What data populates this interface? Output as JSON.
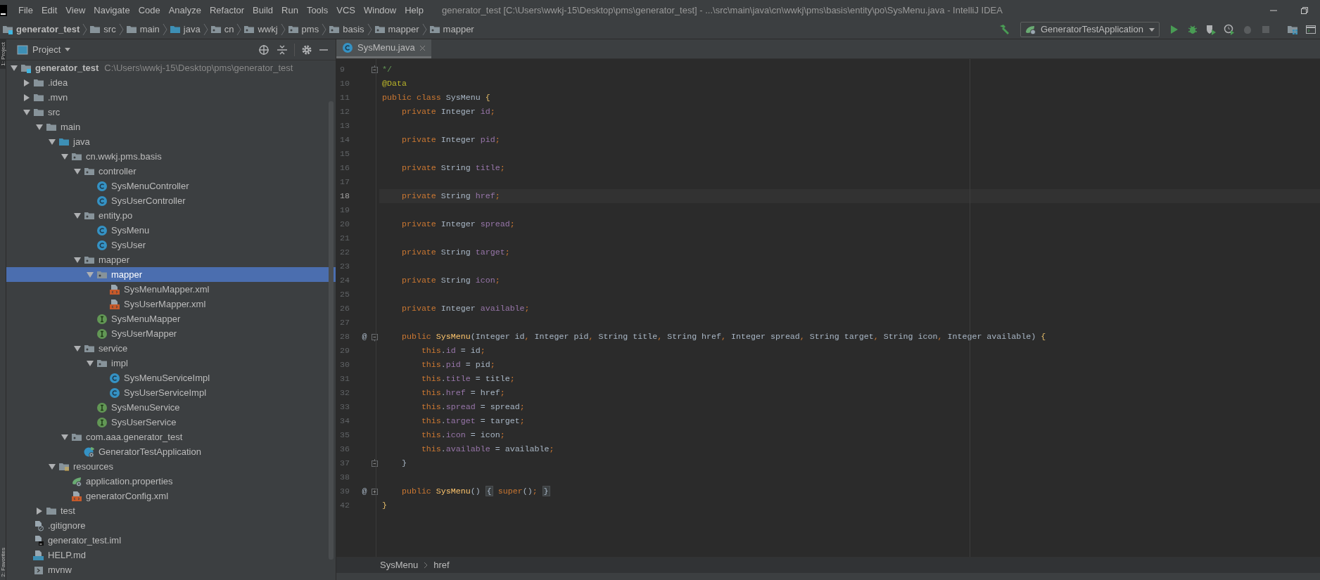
{
  "menu_bar": {
    "items": [
      "File",
      "Edit",
      "View",
      "Navigate",
      "Code",
      "Analyze",
      "Refactor",
      "Build",
      "Run",
      "Tools",
      "VCS",
      "Window",
      "Help"
    ]
  },
  "window": {
    "title": "generator_test [C:\\Users\\wwkj-15\\Desktop\\pms\\generator_test] - ...\\src\\main\\java\\cn\\wwkj\\pms\\basis\\entity\\po\\SysMenu.java - IntelliJ IDEA"
  },
  "navigation_bar": {
    "crumbs": [
      {
        "label": "generator_test",
        "kind": "module"
      },
      {
        "label": "src",
        "kind": "folder"
      },
      {
        "label": "main",
        "kind": "folder"
      },
      {
        "label": "java",
        "kind": "source-folder"
      },
      {
        "label": "cn",
        "kind": "package"
      },
      {
        "label": "wwkj",
        "kind": "package"
      },
      {
        "label": "pms",
        "kind": "package"
      },
      {
        "label": "basis",
        "kind": "package"
      },
      {
        "label": "mapper",
        "kind": "package"
      },
      {
        "label": "mapper",
        "kind": "package"
      }
    ]
  },
  "run_configuration": {
    "label": "GeneratorTestApplication"
  },
  "tool_window_strip": {
    "tabs": [
      {
        "label": "1: Project",
        "selected": true
      },
      {
        "label": "2: Favorites",
        "selected": false
      }
    ]
  },
  "project_panel": {
    "title": "Project",
    "tree": [
      {
        "label": "generator_test",
        "kind": "module",
        "path": "C:\\Users\\wwkj-15\\Desktop\\pms\\generator_test",
        "expanded": true,
        "selected": false,
        "children": [
          {
            "label": ".idea",
            "kind": "folder",
            "expanded": false,
            "selected": false
          },
          {
            "label": ".mvn",
            "kind": "folder",
            "expanded": false,
            "selected": false
          },
          {
            "label": "src",
            "kind": "folder",
            "expanded": true,
            "selected": false,
            "children": [
              {
                "label": "main",
                "kind": "folder",
                "expanded": true,
                "selected": false,
                "children": [
                  {
                    "label": "java",
                    "kind": "source-folder",
                    "expanded": true,
                    "selected": false,
                    "children": [
                      {
                        "label": "cn.wwkj.pms.basis",
                        "kind": "package",
                        "expanded": true,
                        "selected": false,
                        "children": [
                          {
                            "label": "controller",
                            "kind": "package",
                            "expanded": true,
                            "selected": false,
                            "children": [
                              {
                                "label": "SysMenuController",
                                "kind": "class",
                                "selected": false
                              },
                              {
                                "label": "SysUserController",
                                "kind": "class",
                                "selected": false
                              }
                            ]
                          },
                          {
                            "label": "entity.po",
                            "kind": "package",
                            "expanded": true,
                            "selected": false,
                            "children": [
                              {
                                "label": "SysMenu",
                                "kind": "class",
                                "selected": false
                              },
                              {
                                "label": "SysUser",
                                "kind": "class",
                                "selected": false
                              }
                            ]
                          },
                          {
                            "label": "mapper",
                            "kind": "package",
                            "expanded": true,
                            "selected": false,
                            "children": [
                              {
                                "label": "mapper",
                                "kind": "package",
                                "expanded": true,
                                "selected": true,
                                "children": [
                                  {
                                    "label": "SysMenuMapper.xml",
                                    "kind": "xml",
                                    "selected": false
                                  },
                                  {
                                    "label": "SysUserMapper.xml",
                                    "kind": "xml",
                                    "selected": false
                                  }
                                ]
                              },
                              {
                                "label": "SysMenuMapper",
                                "kind": "interface",
                                "selected": false
                              },
                              {
                                "label": "SysUserMapper",
                                "kind": "interface",
                                "selected": false
                              }
                            ]
                          },
                          {
                            "label": "service",
                            "kind": "package",
                            "expanded": true,
                            "selected": false,
                            "children": [
                              {
                                "label": "impl",
                                "kind": "package",
                                "expanded": true,
                                "selected": false,
                                "children": [
                                  {
                                    "label": "SysMenuServiceImpl",
                                    "kind": "class",
                                    "selected": false
                                  },
                                  {
                                    "label": "SysUserServiceImpl",
                                    "kind": "class",
                                    "selected": false
                                  }
                                ]
                              },
                              {
                                "label": "SysMenuService",
                                "kind": "interface",
                                "selected": false
                              },
                              {
                                "label": "SysUserService",
                                "kind": "interface",
                                "selected": false
                              }
                            ]
                          }
                        ]
                      },
                      {
                        "label": "com.aaa.generator_test",
                        "kind": "package",
                        "expanded": true,
                        "selected": false,
                        "children": [
                          {
                            "label": "GeneratorTestApplication",
                            "kind": "spring-class",
                            "selected": false
                          }
                        ]
                      }
                    ]
                  },
                  {
                    "label": "resources",
                    "kind": "resources-folder",
                    "expanded": true,
                    "selected": false,
                    "children": [
                      {
                        "label": "application.properties",
                        "kind": "properties",
                        "selected": false
                      },
                      {
                        "label": "generatorConfig.xml",
                        "kind": "xml",
                        "selected": false
                      }
                    ]
                  }
                ]
              },
              {
                "label": "test",
                "kind": "folder",
                "expanded": false,
                "selected": false
              }
            ]
          },
          {
            "label": ".gitignore",
            "kind": "gitignore",
            "selected": false
          },
          {
            "label": "generator_test.iml",
            "kind": "iml",
            "selected": false
          },
          {
            "label": "HELP.md",
            "kind": "markdown",
            "selected": false
          },
          {
            "label": "mvnw",
            "kind": "script",
            "selected": false
          }
        ]
      }
    ]
  },
  "editor": {
    "tabs": [
      {
        "label": "SysMenu.java",
        "selected": true
      }
    ],
    "lines": [
      {
        "number": "9",
        "current": false,
        "fold": {
          "kind": "end"
        },
        "tokens": [
          {
            "kind": "comment",
            "text": "*/"
          }
        ]
      },
      {
        "number": "10",
        "current": false,
        "tokens": [
          {
            "kind": "annotation",
            "text": "@Data"
          }
        ]
      },
      {
        "number": "11",
        "current": false,
        "tokens": [
          {
            "kind": "keyword",
            "text": "public class "
          },
          {
            "kind": "plain",
            "text": "SysMenu "
          },
          {
            "kind": "brace",
            "text": "{"
          }
        ]
      },
      {
        "number": "12",
        "current": false,
        "tokens": [
          {
            "kind": "keyword",
            "text": "    private "
          },
          {
            "kind": "plain",
            "text": "Integer "
          },
          {
            "kind": "field",
            "text": "id"
          },
          {
            "kind": "keyword",
            "text": ";"
          }
        ]
      },
      {
        "number": "13",
        "current": false
      },
      {
        "number": "14",
        "current": false,
        "tokens": [
          {
            "kind": "keyword",
            "text": "    private "
          },
          {
            "kind": "plain",
            "text": "Integer "
          },
          {
            "kind": "field",
            "text": "pid"
          },
          {
            "kind": "keyword",
            "text": ";"
          }
        ]
      },
      {
        "number": "15",
        "current": false
      },
      {
        "number": "16",
        "current": false,
        "tokens": [
          {
            "kind": "keyword",
            "text": "    private "
          },
          {
            "kind": "plain",
            "text": "String "
          },
          {
            "kind": "field",
            "text": "title"
          },
          {
            "kind": "keyword",
            "text": ";"
          }
        ]
      },
      {
        "number": "17",
        "current": false
      },
      {
        "number": "18",
        "current": true,
        "tokens": [
          {
            "kind": "keyword",
            "text": "    private "
          },
          {
            "kind": "plain",
            "text": "String "
          },
          {
            "kind": "field",
            "text": "href"
          },
          {
            "kind": "keyword",
            "text": ";"
          }
        ]
      },
      {
        "number": "19",
        "current": false
      },
      {
        "number": "20",
        "current": false,
        "tokens": [
          {
            "kind": "keyword",
            "text": "    private "
          },
          {
            "kind": "plain",
            "text": "Integer "
          },
          {
            "kind": "field",
            "text": "spread"
          },
          {
            "kind": "keyword",
            "text": ";"
          }
        ]
      },
      {
        "number": "21",
        "current": false
      },
      {
        "number": "22",
        "current": false,
        "tokens": [
          {
            "kind": "keyword",
            "text": "    private "
          },
          {
            "kind": "plain",
            "text": "String "
          },
          {
            "kind": "field",
            "text": "target"
          },
          {
            "kind": "keyword",
            "text": ";"
          }
        ]
      },
      {
        "number": "23",
        "current": false
      },
      {
        "number": "24",
        "current": false,
        "tokens": [
          {
            "kind": "keyword",
            "text": "    private "
          },
          {
            "kind": "plain",
            "text": "String "
          },
          {
            "kind": "field",
            "text": "icon"
          },
          {
            "kind": "keyword",
            "text": ";"
          }
        ]
      },
      {
        "number": "25",
        "current": false
      },
      {
        "number": "26",
        "current": false,
        "tokens": [
          {
            "kind": "keyword",
            "text": "    private "
          },
          {
            "kind": "plain",
            "text": "Integer "
          },
          {
            "kind": "field",
            "text": "available"
          },
          {
            "kind": "keyword",
            "text": ";"
          }
        ]
      },
      {
        "number": "27",
        "current": false
      },
      {
        "number": "28",
        "current": false,
        "gutter_mark": "@",
        "fold": {
          "kind": "start"
        },
        "tokens": [
          {
            "kind": "keyword",
            "text": "    public "
          },
          {
            "kind": "method",
            "text": "SysMenu"
          },
          {
            "kind": "plain",
            "text": "(Integer id"
          },
          {
            "kind": "keyword",
            "text": ", "
          },
          {
            "kind": "plain",
            "text": "Integer pid"
          },
          {
            "kind": "keyword",
            "text": ", "
          },
          {
            "kind": "plain",
            "text": "String title"
          },
          {
            "kind": "keyword",
            "text": ", "
          },
          {
            "kind": "plain",
            "text": "String href"
          },
          {
            "kind": "keyword",
            "text": ", "
          },
          {
            "kind": "plain",
            "text": "Integer spread"
          },
          {
            "kind": "keyword",
            "text": ", "
          },
          {
            "kind": "plain",
            "text": "String target"
          },
          {
            "kind": "keyword",
            "text": ", "
          },
          {
            "kind": "plain",
            "text": "String icon"
          },
          {
            "kind": "keyword",
            "text": ", "
          },
          {
            "kind": "plain",
            "text": "Integer available) "
          },
          {
            "kind": "brace",
            "text": "{"
          }
        ]
      },
      {
        "number": "29",
        "current": false,
        "tokens": [
          {
            "kind": "keyword",
            "text": "        this"
          },
          {
            "kind": "plain",
            "text": "."
          },
          {
            "kind": "field",
            "text": "id"
          },
          {
            "kind": "plain",
            "text": " = id"
          },
          {
            "kind": "keyword",
            "text": ";"
          }
        ]
      },
      {
        "number": "30",
        "current": false,
        "tokens": [
          {
            "kind": "keyword",
            "text": "        this"
          },
          {
            "kind": "plain",
            "text": "."
          },
          {
            "kind": "field",
            "text": "pid"
          },
          {
            "kind": "plain",
            "text": " = pid"
          },
          {
            "kind": "keyword",
            "text": ";"
          }
        ]
      },
      {
        "number": "31",
        "current": false,
        "tokens": [
          {
            "kind": "keyword",
            "text": "        this"
          },
          {
            "kind": "plain",
            "text": "."
          },
          {
            "kind": "field",
            "text": "title"
          },
          {
            "kind": "plain",
            "text": " = title"
          },
          {
            "kind": "keyword",
            "text": ";"
          }
        ]
      },
      {
        "number": "32",
        "current": false,
        "tokens": [
          {
            "kind": "keyword",
            "text": "        this"
          },
          {
            "kind": "plain",
            "text": "."
          },
          {
            "kind": "field",
            "text": "href"
          },
          {
            "kind": "plain",
            "text": " = href"
          },
          {
            "kind": "keyword",
            "text": ";"
          }
        ]
      },
      {
        "number": "33",
        "current": false,
        "tokens": [
          {
            "kind": "keyword",
            "text": "        this"
          },
          {
            "kind": "plain",
            "text": "."
          },
          {
            "kind": "field",
            "text": "spread"
          },
          {
            "kind": "plain",
            "text": " = spread"
          },
          {
            "kind": "keyword",
            "text": ";"
          }
        ]
      },
      {
        "number": "34",
        "current": false,
        "tokens": [
          {
            "kind": "keyword",
            "text": "        this"
          },
          {
            "kind": "plain",
            "text": "."
          },
          {
            "kind": "field",
            "text": "target"
          },
          {
            "kind": "plain",
            "text": " = target"
          },
          {
            "kind": "keyword",
            "text": ";"
          }
        ]
      },
      {
        "number": "35",
        "current": false,
        "tokens": [
          {
            "kind": "keyword",
            "text": "        this"
          },
          {
            "kind": "plain",
            "text": "."
          },
          {
            "kind": "field",
            "text": "icon"
          },
          {
            "kind": "plain",
            "text": " = icon"
          },
          {
            "kind": "keyword",
            "text": ";"
          }
        ]
      },
      {
        "number": "36",
        "current": false,
        "tokens": [
          {
            "kind": "keyword",
            "text": "        this"
          },
          {
            "kind": "plain",
            "text": "."
          },
          {
            "kind": "field",
            "text": "available"
          },
          {
            "kind": "plain",
            "text": " = available"
          },
          {
            "kind": "keyword",
            "text": ";"
          }
        ]
      },
      {
        "number": "37",
        "current": false,
        "fold": {
          "kind": "end"
        },
        "tokens": [
          {
            "kind": "plain",
            "text": "    }"
          }
        ]
      },
      {
        "number": "38",
        "current": false
      },
      {
        "number": "39",
        "current": false,
        "gutter_mark": "@",
        "fold": {
          "kind": "folded"
        },
        "tokens": [
          {
            "kind": "keyword",
            "text": "    public "
          },
          {
            "kind": "method",
            "text": "SysMenu"
          },
          {
            "kind": "plain",
            "text": "() "
          },
          {
            "kind": "folded-brace",
            "text": "{"
          },
          {
            "kind": "keyword",
            "text": " super"
          },
          {
            "kind": "plain",
            "text": "()"
          },
          {
            "kind": "keyword",
            "text": "; "
          },
          {
            "kind": "folded-brace",
            "text": "}"
          }
        ]
      },
      {
        "number": "42",
        "current": false,
        "tokens": [
          {
            "kind": "brace",
            "text": "}"
          }
        ]
      }
    ]
  },
  "breadcrumbs": [
    "SysMenu",
    "href"
  ]
}
